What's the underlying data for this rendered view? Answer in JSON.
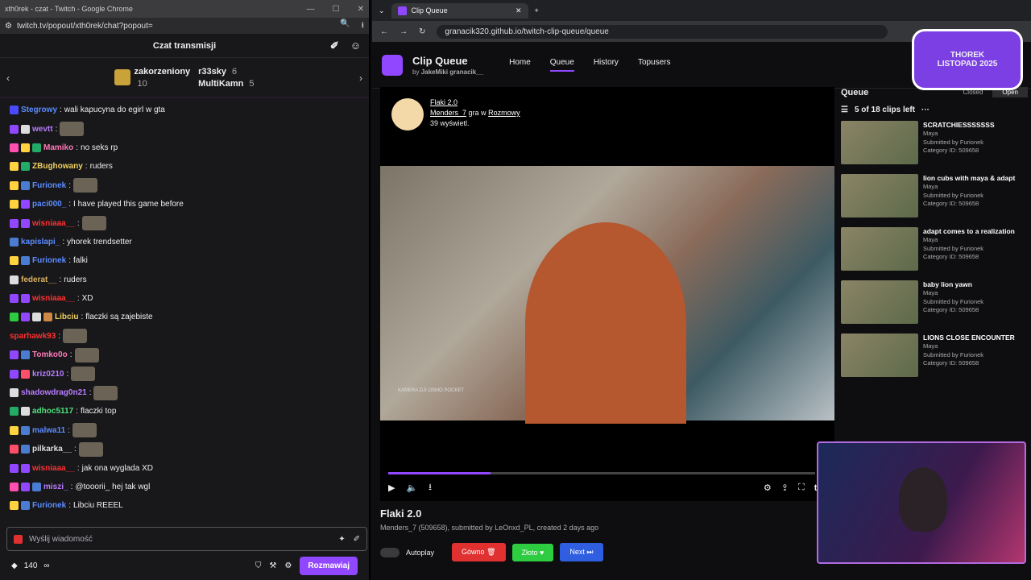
{
  "chat_window": {
    "title": "xth0rek - czat - Twitch - Google Chrome",
    "url": "twitch.tv/popout/xth0rek/chat?popout=",
    "header": "Czat transmisji",
    "gifts": {
      "main_user": "zakorzeniony",
      "main_count": "10",
      "users": [
        {
          "name": "r33sky",
          "count": "6"
        },
        {
          "name": "MultiKamn",
          "count": "5"
        }
      ]
    },
    "messages": [
      {
        "user": "Stegrowy",
        "color": "#5b8cff",
        "text": "wali kapucyna do egirl w gta",
        "badges": [
          "#4a4aff"
        ]
      },
      {
        "user": "wevtt",
        "color": "#b97cff",
        "text": "",
        "badges": [
          "#9147ff",
          "#ddd"
        ]
      },
      {
        "user": "Mamiko",
        "color": "#ff7ab8",
        "text": "no seks rp",
        "badges": [
          "#ff4fb0",
          "#ffd23f",
          "#22aa66"
        ]
      },
      {
        "user": "ZBughowany",
        "color": "#f0d060",
        "text": "ruders",
        "badges": [
          "#ffd23f",
          "#22aa66"
        ]
      },
      {
        "user": "Furionek",
        "color": "#5b8cff",
        "text": "",
        "badges": [
          "#ffd23f",
          "#4a7dd1"
        ]
      },
      {
        "user": "paci000_",
        "color": "#5b8cff",
        "text": "I have played this game before",
        "badges": [
          "#ffd23f",
          "#9147ff"
        ]
      },
      {
        "user": "wisniaaa__",
        "color": "#ff3030",
        "text": "",
        "badges": [
          "#9147ff",
          "#9147ff"
        ]
      },
      {
        "user": "kapislapi_",
        "color": "#5b8cff",
        "text": "yhorek trendsetter",
        "badges": [
          "#4a7dd1"
        ]
      },
      {
        "user": "Furionek",
        "color": "#5b8cff",
        "text": "falki",
        "badges": [
          "#ffd23f",
          "#4a7dd1"
        ]
      },
      {
        "user": "federat__",
        "color": "#d9b060",
        "text": "ruders",
        "badges": [
          "#ddd"
        ]
      },
      {
        "user": "wisniaaa__",
        "color": "#ff3030",
        "text": "XD",
        "badges": [
          "#9147ff",
          "#9147ff"
        ]
      },
      {
        "user": "Libciu",
        "color": "#f0d060",
        "text": "flaczki są zajebiste",
        "badges": [
          "#2ecc40",
          "#9147ff",
          "#ddd",
          "#cc8844"
        ]
      },
      {
        "user": "sparhawk93",
        "color": "#ff3030",
        "text": "",
        "badges": []
      },
      {
        "user": "Tomko0o",
        "color": "#ff7ab8",
        "text": "",
        "badges": [
          "#9147ff",
          "#4a7dd1"
        ]
      },
      {
        "user": "kriz0210",
        "color": "#b97cff",
        "text": "",
        "badges": [
          "#9147ff",
          "#ff4f6a"
        ]
      },
      {
        "user": "shadowdrag0n21",
        "color": "#b97cff",
        "text": "",
        "badges": [
          "#ddd"
        ]
      },
      {
        "user": "adhoc5117",
        "color": "#4ee07a",
        "text": "flaczki top",
        "badges": [
          "#22aa66",
          "#ddd"
        ]
      },
      {
        "user": "malwa11",
        "color": "#5b8cff",
        "text": "",
        "badges": [
          "#ffd23f",
          "#4a7dd1"
        ]
      },
      {
        "user": "pilkarka__",
        "color": "#ddd",
        "text": "",
        "badges": [
          "#ff4f6a",
          "#4a7dd1"
        ]
      },
      {
        "user": "wisniaaa__",
        "color": "#ff3030",
        "text": "jak ona wyglada XD",
        "badges": [
          "#9147ff",
          "#9147ff"
        ]
      },
      {
        "user": "miszi_",
        "color": "#b97cff",
        "text": "@tooorii_ hej tak wgl",
        "badges": [
          "#ff4fb0",
          "#9147ff",
          "#4a7dd1"
        ]
      },
      {
        "user": "Furionek",
        "color": "#5b8cff",
        "text": "Libciu REEEL",
        "badges": [
          "#ffd23f",
          "#4a7dd1"
        ]
      }
    ],
    "input_placeholder": "Wyślij wiadomość",
    "points": "140",
    "points_suffix": "∞",
    "send_label": "Rozmawiaj"
  },
  "queue_window": {
    "tab_title": "Clip Queue",
    "url": "granacik320.github.io/twitch-clip-queue/queue",
    "app_title": "Clip Queue",
    "app_sub_by": "by",
    "app_sub_author1": "JakeMiki",
    "app_sub_author2": "granacik__",
    "nav": [
      "Home",
      "Queue",
      "History",
      "Topusers"
    ],
    "nav_active": "Queue",
    "clip": {
      "channel": "Flaki 2.0",
      "streamer": "Menders_7",
      "streamer_game_prefix": "gra w",
      "category": "Rozmowy",
      "views": "39 wyświetl.",
      "cam_label": "KAMERA DJI OSMO POCKET",
      "title": "Flaki 2.0",
      "meta": "Menders_7 (509658), submitted by LeOnxd_PL, created 2 days ago"
    },
    "actions": {
      "autoplay": "Autoplay",
      "bad": "Gówno",
      "good": "Złoto",
      "next": "Next"
    },
    "queue": {
      "title": "Queue",
      "closed": "Closed",
      "open": "Open",
      "count_text": "5 of 18 clips left",
      "items": [
        {
          "title": "SCRATCHIESSSSSSS",
          "author": "Maya",
          "submitted": "Submitted by Furionek",
          "category": "Category ID: 509658"
        },
        {
          "title": "lion cubs with maya & adapt",
          "author": "Maya",
          "submitted": "Submitted by Furionek",
          "category": "Category ID: 509658"
        },
        {
          "title": "adapt comes to a realization",
          "author": "Maya",
          "submitted": "Submitted by Furionek",
          "category": "Category ID: 509658"
        },
        {
          "title": "baby lion yawn",
          "author": "Maya",
          "submitted": "Submitted by Furionek",
          "category": "Category ID: 509658"
        },
        {
          "title": "LIONS CLOSE ENCOUNTER",
          "author": "Maya",
          "submitted": "Submitted by Furionek",
          "category": "Category ID: 509658"
        }
      ]
    },
    "overlay_badge": {
      "line1": "THOREK",
      "line2": "LISTOPAD 2025"
    }
  }
}
